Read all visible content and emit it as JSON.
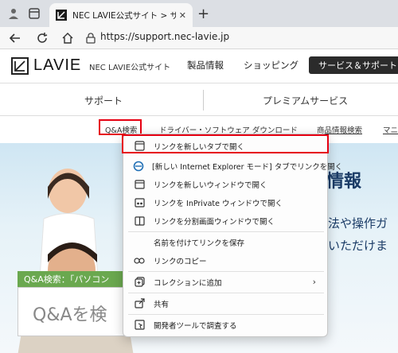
{
  "browser": {
    "tab_title": "NEC LAVIE公式サイト > サービス＆サ",
    "url": "https://support.nec-lavie.jp"
  },
  "site": {
    "logo_text": "LAVIE",
    "site_name": "NEC LAVIE公式サイト",
    "nav": [
      "製品情報",
      "ショッピング",
      "サービス＆サポート"
    ],
    "subnav": [
      "サポート",
      "プレミアムサービス"
    ],
    "links": [
      "Q&A検索",
      "ドライバー・ソフトウェア ダウンロード",
      "商品情報検索",
      "マニ"
    ]
  },
  "hero": {
    "heading_fragment": "情報",
    "line1_fragment": "法や操作ガ",
    "line2_fragment": "いただけま",
    "search_label": "Q&A検索：「パソコン",
    "search_placeholder": "Q&Aを検"
  },
  "context_menu": {
    "items": [
      {
        "label": "リンクを新しいタブで開く",
        "icon": "new-tab-icon"
      },
      {
        "label": "[新しい Internet Explorer モード] タブでリンクを開く",
        "icon": "ie-icon"
      },
      {
        "label": "リンクを新しいウィンドウで開く",
        "icon": "new-window-icon"
      },
      {
        "label": "リンクを InPrivate ウィンドウで開く",
        "icon": "inprivate-icon"
      },
      {
        "label": "リンクを分割画面ウィンドウで開く",
        "icon": "split-screen-icon"
      },
      {
        "label": "名前を付けてリンクを保存",
        "icon": ""
      },
      {
        "label": "リンクのコピー",
        "icon": "link-icon"
      },
      {
        "label": "コレクションに追加",
        "icon": "collections-icon"
      },
      {
        "label": "共有",
        "icon": "share-icon"
      },
      {
        "label": "開発者ツールで調査する",
        "icon": "devtools-icon"
      }
    ],
    "submenu_arrow": "›"
  },
  "colors": {
    "highlight": "#e60012",
    "support_nav_bg": "#2b2b2b",
    "search_label_bg": "#6aa84f"
  }
}
